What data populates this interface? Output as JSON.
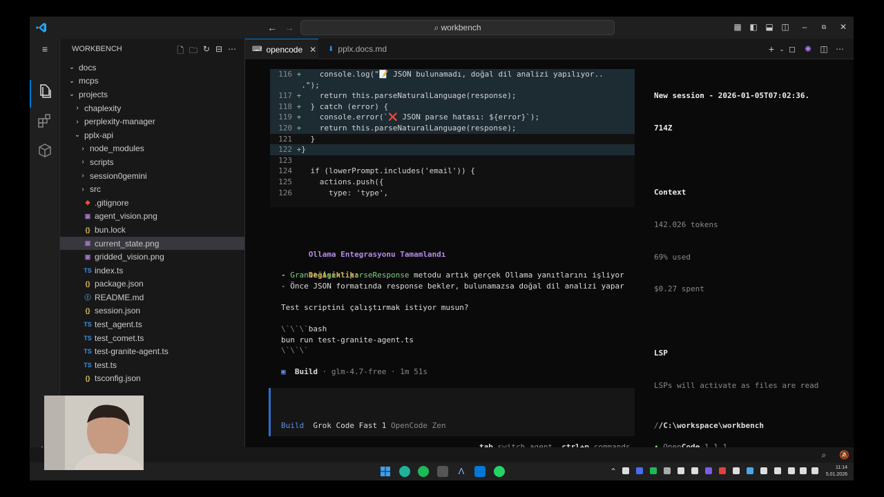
{
  "titlebar": {
    "search_text": "workbench"
  },
  "sidebar": {
    "header": "WORKBENCH",
    "items": [
      {
        "label": "docs",
        "type": "folder-open",
        "depth": 0
      },
      {
        "label": "mcps",
        "type": "folder-open",
        "depth": 0
      },
      {
        "label": "projects",
        "type": "folder-open",
        "depth": 0
      },
      {
        "label": "chaplexity",
        "type": "folder",
        "depth": 1
      },
      {
        "label": "perplexity-manager",
        "type": "folder",
        "depth": 1
      },
      {
        "label": "pplx-api",
        "type": "folder-open",
        "depth": 1
      },
      {
        "label": "node_modules",
        "type": "folder",
        "depth": 2
      },
      {
        "label": "scripts",
        "type": "folder",
        "depth": 2
      },
      {
        "label": "session0gemini",
        "type": "folder",
        "depth": 2
      },
      {
        "label": "src",
        "type": "folder",
        "depth": 2
      },
      {
        "label": ".gitignore",
        "type": "git",
        "depth": 2
      },
      {
        "label": "agent_vision.png",
        "type": "image",
        "depth": 2
      },
      {
        "label": "bun.lock",
        "type": "json",
        "depth": 2
      },
      {
        "label": "current_state.png",
        "type": "image",
        "depth": 2
      },
      {
        "label": "gridded_vision.png",
        "type": "image",
        "depth": 2
      },
      {
        "label": "index.ts",
        "type": "ts",
        "depth": 2
      },
      {
        "label": "package.json",
        "type": "json",
        "depth": 2
      },
      {
        "label": "README.md",
        "type": "info",
        "depth": 2
      },
      {
        "label": "session.json",
        "type": "json",
        "depth": 2
      },
      {
        "label": "test_agent.ts",
        "type": "ts",
        "depth": 2
      },
      {
        "label": "test_comet.ts",
        "type": "ts",
        "depth": 2
      },
      {
        "label": "test-granite-agent.ts",
        "type": "ts",
        "depth": 2
      },
      {
        "label": "test.ts",
        "type": "ts",
        "depth": 2
      },
      {
        "label": "tsconfig.json",
        "type": "json",
        "depth": 2
      }
    ],
    "selected_index": 13
  },
  "tabs": [
    {
      "label": "opencode",
      "active": true
    },
    {
      "label": "pplx.docs.md",
      "active": false
    }
  ],
  "diff": {
    "lines": [
      {
        "n": "116",
        "sign": "+",
        "added": true,
        "text": "    console.log(\"📝 JSON bulunamadı, doğal dil analizi yapılıyor.."
      },
      {
        "n": "",
        "sign": "",
        "added": true,
        "text": " .\");"
      },
      {
        "n": "117",
        "sign": "+",
        "added": true,
        "text": "    return this.parseNaturalLanguage(response);"
      },
      {
        "n": "118",
        "sign": "+",
        "added": true,
        "text": "  } catch (error) {"
      },
      {
        "n": "119",
        "sign": "+",
        "added": true,
        "text": "    console.error(`❌ JSON parse hatası: ${error}`);"
      },
      {
        "n": "120",
        "sign": "+",
        "added": true,
        "text": "    return this.parseNaturalLanguage(response);"
      },
      {
        "n": "121",
        "sign": " ",
        "added": false,
        "text": "  }"
      },
      {
        "n": "122",
        "sign": "+",
        "added": true,
        "text": "}"
      },
      {
        "n": "123",
        "sign": " ",
        "added": false,
        "text": ""
      },
      {
        "n": "124",
        "sign": " ",
        "added": false,
        "text": "  if (lowerPrompt.includes('email')) {"
      },
      {
        "n": "125",
        "sign": " ",
        "added": false,
        "text": "    actions.push({"
      },
      {
        "n": "126",
        "sign": " ",
        "added": false,
        "text": "      type: 'type',"
      }
    ]
  },
  "message": {
    "title": "Ollama Entegrasyonu Tamamlandı",
    "change_label": "Değişiklik:",
    "bullet1_prefix": "- ",
    "bullet1_code": "GraniteAgent.parseResponse",
    "bullet1_rest": " metodu artık gerçek Ollama yanıtlarını işliyor",
    "bullet2": "- Önce JSON formatında response bekler, bulunamazsa doğal dil analizi yapar",
    "question": "Test scriptini çalıştırmak istiyor musun?",
    "fence_open_ticks": "\\`\\`\\`",
    "fence_lang": "bash",
    "command": "bun run test-granite-agent.ts",
    "fence_close": "\\`\\`\\`"
  },
  "build_status": {
    "icon": "▣",
    "label": "Build",
    "meta": " · glm-4.7-free · 1m 51s"
  },
  "input": {
    "agent": "Build",
    "model": "Grok Code Fast 1",
    "provider": "OpenCode Zen"
  },
  "hints": {
    "key1": "tab",
    "desc1": "switch agent",
    "key2": "ctrl+p",
    "desc2": "commands"
  },
  "session": {
    "title_line1": "New session - 2026-01-05T07:02:36.",
    "title_line2": "714Z",
    "context_label": "Context",
    "tokens": "142.026 tokens",
    "used": "69% used",
    "spent": "$0.27 spent",
    "lsp_label": "LSP",
    "lsp_text": "LSPs will activate as files are read",
    "path": "/C:\\workspace\\workbench",
    "app_name_open": "Open",
    "app_name_code": "Code",
    "version": "1.1.1"
  },
  "clock": {
    "time": "11:14",
    "date": "5.01.2026"
  },
  "colors": {
    "accent": "#0078d4",
    "added_bg": "#1d2b33",
    "purple": "#b48ae8",
    "orange": "#f0a050",
    "green": "#7fd07f"
  }
}
